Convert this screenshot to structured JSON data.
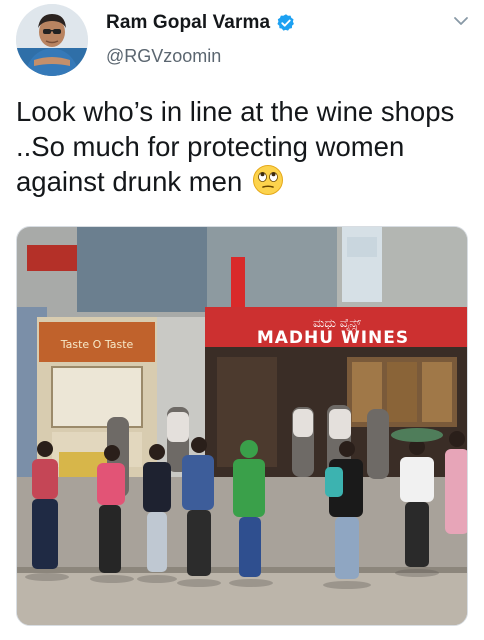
{
  "user": {
    "display_name": "Ram Gopal Varma",
    "handle": "@RGVzoomin",
    "verified": true
  },
  "tweet": {
    "text": "Look who’s in line at the wine shops ..So much for protecting women against drunk men",
    "emoji": "face-with-rolling-eyes"
  },
  "media": {
    "store_sign": "MADHU WINES",
    "left_shop_sign": "Taste O Taste"
  },
  "icons": {
    "menu": "chevron-down-icon",
    "verified": "verified-badge-icon"
  },
  "colors": {
    "verified_blue": "#1da1f2",
    "text_primary": "#14171a",
    "text_secondary": "#5b6670"
  }
}
